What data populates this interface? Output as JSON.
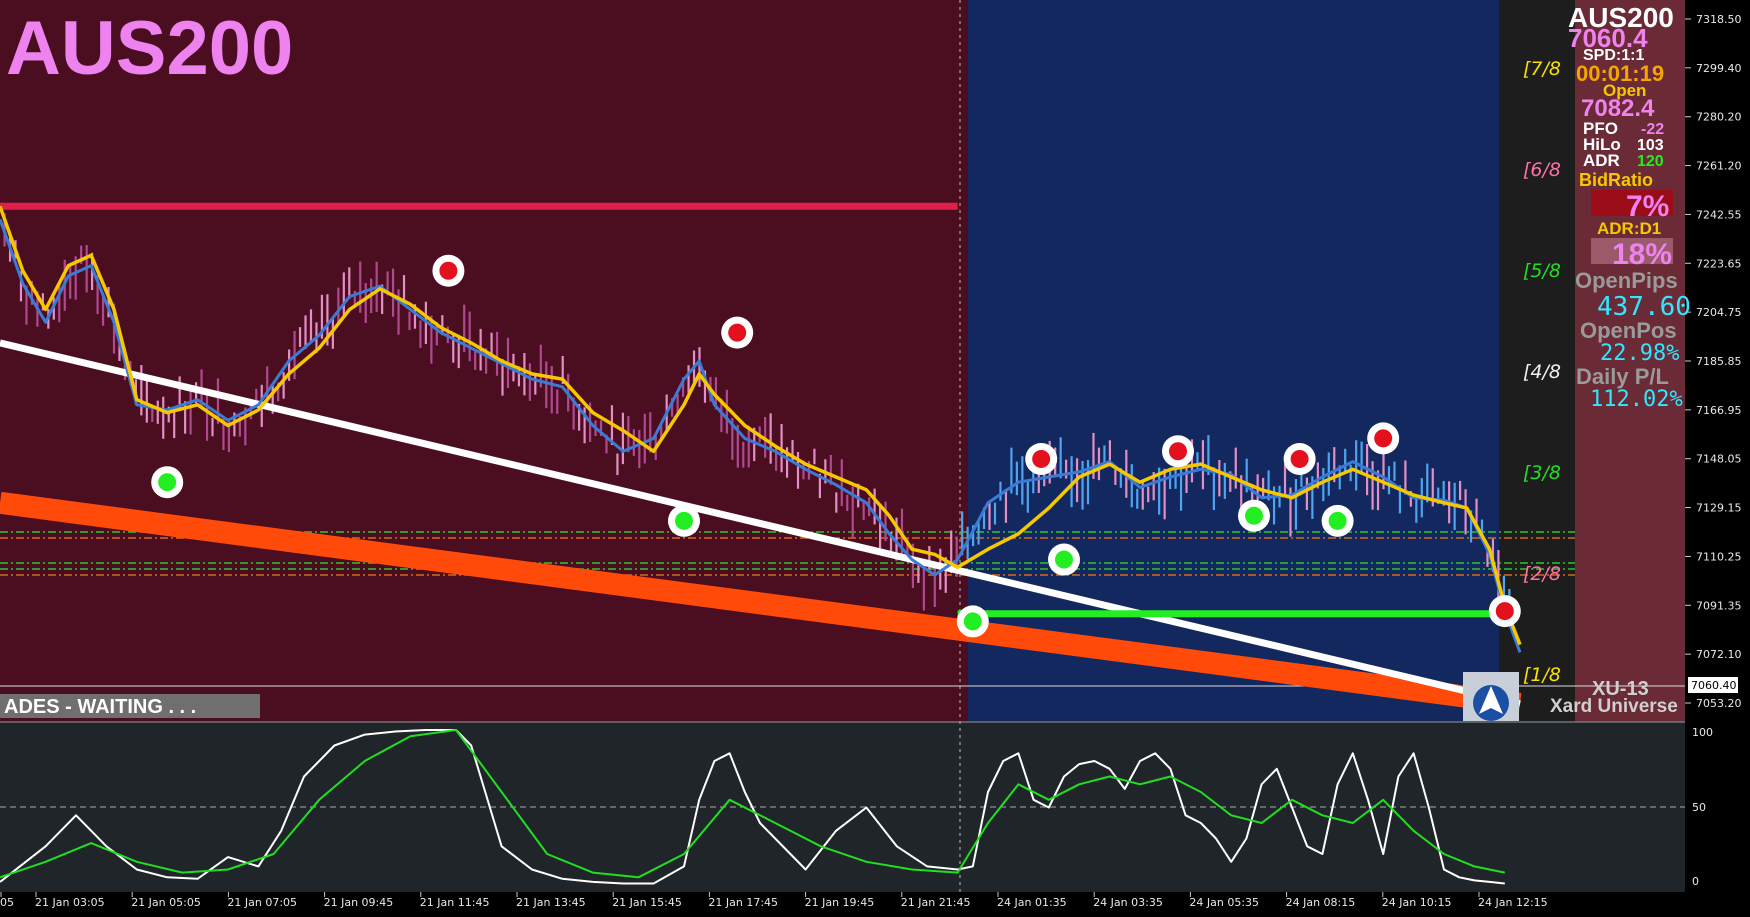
{
  "symbol_title": "AUS200",
  "status_banner": "ADES - WAITING . . .",
  "watermark": {
    "code": "XU-13",
    "brand": "Xard Universe"
  },
  "colors": {
    "background_left": "#4a0e20",
    "background_right": "#13285e",
    "right_panel": "#6a2a36",
    "title": "#ee82ee",
    "ema_fast": "#3a7bd5",
    "ema_slow": "#f5c800",
    "trend_white": "#ffffff",
    "trend_orange": "#ff4a0a",
    "resistance": "#e0204a",
    "support": "#22ee22",
    "osc_main": "#ffffff",
    "osc_signal": "#22dd22"
  },
  "info_panel": {
    "symbol": "AUS200",
    "price": "7060.4",
    "spread": "SPD:1:1",
    "timer": "00:01:19",
    "open_label": "Open",
    "open_value": "7082.4",
    "rows": [
      {
        "label": "PFO",
        "value": "-22"
      },
      {
        "label": "HiLo",
        "value": "103"
      },
      {
        "label": "ADR",
        "value": "120"
      }
    ],
    "bidratio_label": "BidRatio",
    "bidratio_value": "7%",
    "adr_d1_label": "ADR:D1",
    "adr_d1_value": "18%",
    "open_pips_label": "OpenPips",
    "open_pips_value": "437.60",
    "open_pos_label": "OpenPos",
    "open_pos_value": "22.98%",
    "daily_pl_label": "Daily P/L",
    "daily_pl_value": "112.02%"
  },
  "murrey_labels": [
    "[7/8",
    "[6/8",
    "[5/8",
    "[4/8",
    "[3/8",
    "[2/8",
    "[1/8"
  ],
  "chart_data": [
    {
      "type": "line",
      "title": "AUS200",
      "ylim": [
        7045,
        7325
      ],
      "y_ticks": [
        "7318.50",
        "7299.40",
        "7280.20",
        "7261.20",
        "7242.55",
        "7223.65",
        "7204.75",
        "7185.85",
        "7166.95",
        "7148.05",
        "7129.15",
        "7110.25",
        "7091.35",
        "7072.10",
        "7053.20"
      ],
      "current_price_tag": "7060.40",
      "x_tick_labels": [
        "05",
        "21 Jan 03:05",
        "21 Jan 05:05",
        "21 Jan 07:05",
        "21 Jan 09:45",
        "21 Jan 11:45",
        "21 Jan 13:45",
        "21 Jan 15:45",
        "21 Jan 17:45",
        "21 Jan 19:45",
        "21 Jan 21:45",
        "24 Jan 01:35",
        "24 Jan 03:35",
        "24 Jan 05:35",
        "24 Jan 08:15",
        "24 Jan 10:15",
        "24 Jan 12:15"
      ],
      "x_range": [
        0,
        100
      ],
      "series": [
        {
          "name": "",
          "role": "slow-ma",
          "x": [
            0,
            1.5,
            3,
            4.5,
            6,
            7.5,
            9,
            11,
            13,
            15,
            17,
            19,
            21,
            23,
            25,
            27,
            29,
            31,
            33,
            35,
            37,
            39,
            41,
            43,
            45,
            46,
            47,
            49,
            51,
            53,
            55,
            57,
            58.5,
            60,
            61.5,
            63,
            65,
            67,
            69,
            71,
            73,
            75,
            77,
            79,
            81,
            83,
            85,
            87,
            89,
            91,
            93,
            95,
            96.5,
            98,
            99,
            100
          ],
          "y": [
            7245,
            7220,
            7205,
            7222,
            7226,
            7205,
            7170,
            7165,
            7168,
            7160,
            7166,
            7180,
            7190,
            7205,
            7213,
            7207,
            7198,
            7192,
            7185,
            7180,
            7178,
            7165,
            7158,
            7150,
            7168,
            7180,
            7172,
            7160,
            7152,
            7145,
            7140,
            7135,
            7125,
            7112,
            7110,
            7105,
            7112,
            7118,
            7128,
            7140,
            7145,
            7138,
            7143,
            7145,
            7140,
            7135,
            7132,
            7138,
            7143,
            7138,
            7133,
            7130,
            7128,
            7112,
            7090,
            7075
          ]
        },
        {
          "name": "",
          "role": "fast-ma",
          "x": [
            0,
            1.5,
            3,
            4.5,
            6,
            7.5,
            9,
            11,
            13,
            15,
            17,
            19,
            21,
            23,
            25,
            27,
            29,
            31,
            33,
            35,
            37,
            39,
            41,
            43,
            45,
            46,
            47,
            49,
            51,
            53,
            55,
            57,
            58.5,
            60,
            61.5,
            63,
            65,
            67,
            69,
            71,
            73,
            75,
            77,
            79,
            81,
            83,
            85,
            87,
            89,
            91,
            93,
            95,
            96.5,
            98,
            99,
            100
          ],
          "y": [
            7240,
            7215,
            7200,
            7218,
            7222,
            7200,
            7168,
            7166,
            7170,
            7162,
            7168,
            7185,
            7195,
            7210,
            7214,
            7205,
            7196,
            7190,
            7184,
            7178,
            7175,
            7160,
            7150,
            7155,
            7178,
            7185,
            7168,
            7155,
            7150,
            7143,
            7137,
            7130,
            7118,
            7108,
            7102,
            7108,
            7130,
            7138,
            7140,
            7142,
            7146,
            7136,
            7140,
            7143,
            7141,
            7132,
            7133,
            7140,
            7146,
            7140,
            7132,
            7131,
            7128,
            7110,
            7088,
            7072
          ]
        },
        {
          "name": "",
          "role": "trendline-white",
          "x": [
            0,
            100
          ],
          "y": [
            7192,
            7052
          ]
        },
        {
          "name": "",
          "role": "trendline-orange",
          "x": [
            0,
            100
          ],
          "y": [
            7130,
            7052
          ]
        },
        {
          "name": "",
          "role": "resistance",
          "x": [
            0,
            63
          ],
          "y": [
            7245,
            7245
          ]
        },
        {
          "name": "",
          "role": "support",
          "x": [
            63,
            99
          ],
          "y": [
            7087,
            7087
          ]
        }
      ],
      "swing_highs": [
        {
          "x": 29.5,
          "y": 7220
        },
        {
          "x": 48.5,
          "y": 7196
        },
        {
          "x": 68.5,
          "y": 7147
        },
        {
          "x": 77.5,
          "y": 7150
        },
        {
          "x": 85.5,
          "y": 7147
        },
        {
          "x": 91.0,
          "y": 7155
        },
        {
          "x": 99.0,
          "y": 7088
        }
      ],
      "swing_lows": [
        {
          "x": 11.0,
          "y": 7138
        },
        {
          "x": 45.0,
          "y": 7123
        },
        {
          "x": 64.0,
          "y": 7084
        },
        {
          "x": 70.0,
          "y": 7108
        },
        {
          "x": 82.5,
          "y": 7125
        },
        {
          "x": 88.0,
          "y": 7123
        }
      ]
    },
    {
      "type": "line",
      "title": "",
      "ylim": [
        0,
        100
      ],
      "y_ticks": [
        "100",
        "50",
        "0"
      ],
      "x_range": [
        0,
        100
      ],
      "series": [
        {
          "name": "",
          "role": "osc-main",
          "x": [
            0,
            3,
            5,
            7,
            9,
            11,
            13,
            15,
            17,
            18.5,
            20,
            22,
            24,
            26,
            28,
            30,
            31,
            33,
            35,
            37,
            39,
            41,
            43,
            45,
            46,
            47,
            48,
            49,
            50,
            51,
            52,
            53,
            55,
            57,
            59,
            61,
            63,
            64,
            65,
            66,
            67,
            68,
            69,
            70,
            71,
            72,
            73,
            74,
            75,
            76,
            77,
            78,
            79,
            80,
            81,
            82,
            83,
            84,
            85,
            86,
            87,
            88,
            89,
            90,
            91,
            92,
            93,
            94,
            95,
            96,
            97,
            98,
            99
          ],
          "y": [
            2,
            25,
            45,
            25,
            10,
            5,
            4,
            18,
            12,
            35,
            70,
            90,
            97,
            99,
            100,
            100,
            90,
            25,
            10,
            4,
            2,
            1,
            1,
            12,
            55,
            80,
            85,
            60,
            40,
            30,
            20,
            10,
            35,
            50,
            25,
            12,
            10,
            12,
            60,
            80,
            85,
            55,
            50,
            70,
            78,
            80,
            75,
            62,
            80,
            85,
            75,
            45,
            40,
            30,
            15,
            30,
            65,
            75,
            50,
            25,
            20,
            65,
            85,
            55,
            20,
            70,
            85,
            50,
            10,
            5,
            3,
            2,
            1
          ]
        },
        {
          "name": "",
          "role": "osc-signal",
          "x": [
            0,
            3,
            6,
            9,
            12,
            15,
            18,
            21,
            24,
            27,
            30,
            33,
            36,
            39,
            42,
            45,
            48,
            51,
            54,
            57,
            60,
            63,
            65,
            67,
            69,
            71,
            73,
            75,
            77,
            79,
            81,
            83,
            85,
            87,
            89,
            91,
            93,
            95,
            97,
            99
          ],
          "y": [
            5,
            15,
            27,
            15,
            8,
            10,
            20,
            55,
            80,
            96,
            100,
            60,
            20,
            8,
            5,
            20,
            55,
            40,
            25,
            15,
            10,
            8,
            40,
            65,
            55,
            65,
            70,
            65,
            70,
            60,
            45,
            40,
            55,
            45,
            40,
            55,
            35,
            20,
            12,
            8
          ]
        }
      ]
    }
  ]
}
